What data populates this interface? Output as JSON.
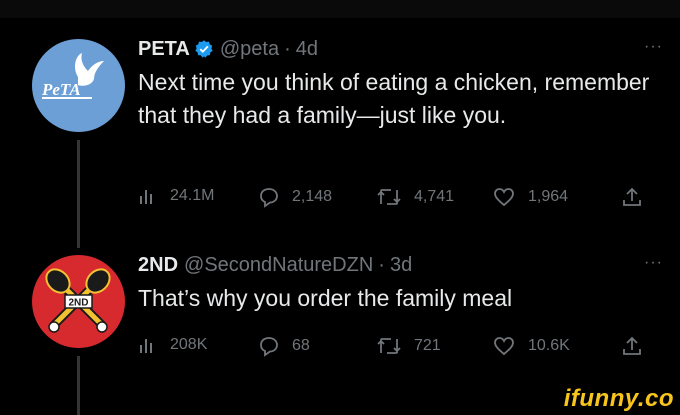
{
  "tweets": [
    {
      "name": "PETA",
      "handle": "@peta",
      "separator": "·",
      "time": "4d",
      "more": "···",
      "avatar_text": "PeTA",
      "text": "Next time you think of eating a chicken, remember that they had a family—just like you.",
      "stats": {
        "views": "24.1M",
        "replies": "2,148",
        "retweets": "4,741",
        "likes": "1,964"
      }
    },
    {
      "name": "2ND",
      "handle": "@SecondNatureDZN",
      "separator": "·",
      "time": "3d",
      "more": "···",
      "avatar_text": "2ND",
      "text": "That’s why you order the family meal",
      "stats": {
        "views": "208K",
        "replies": "68",
        "retweets": "721",
        "likes": "10.6K"
      }
    }
  ],
  "watermark": "ifunny.co",
  "colors": {
    "background": "#000000",
    "text": "#e7e9ea",
    "muted": "#71767b",
    "verified": "#1d9bf0",
    "peta_avatar": "#6c9fd6",
    "second_avatar": "#d62a2f",
    "watermark": "#f8c51c"
  }
}
